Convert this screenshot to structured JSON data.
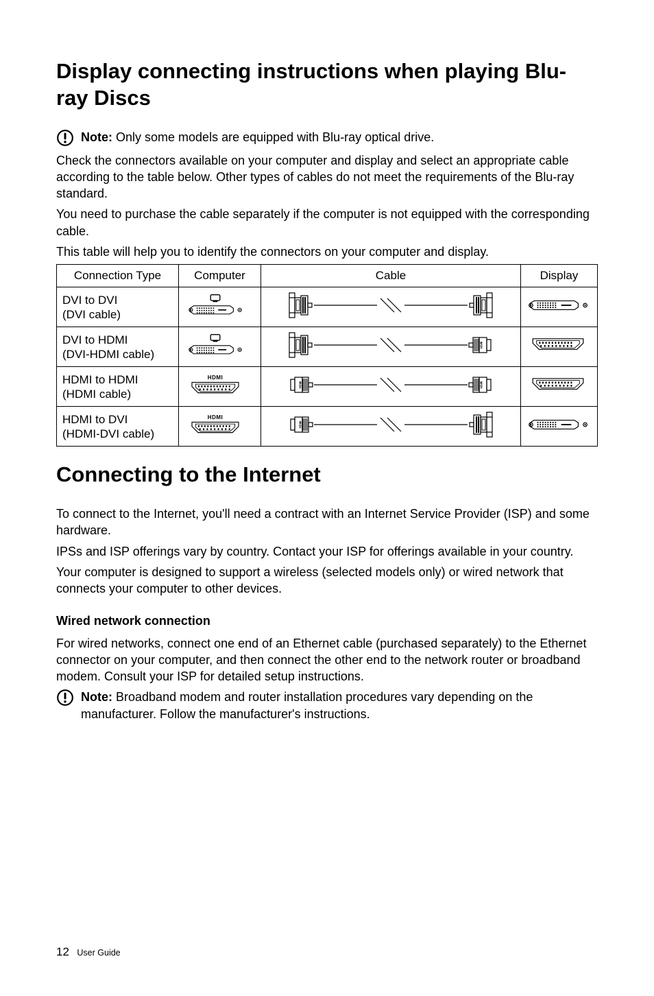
{
  "headings": {
    "display_instructions": "Display connecting instructions when playing Blu-ray Discs",
    "connecting_internet": "Connecting to the Internet"
  },
  "notes": {
    "label": "Note:",
    "bluray": "Only some models are equipped with Blu-ray optical drive.",
    "broadband": "Broadband modem and router installation procedures vary depending on the manufacturer. Follow the manufacturer's instructions."
  },
  "paragraphs": {
    "check_connectors": "Check the connectors available on your computer and display and select an appropriate cable according to the table below. Other types of cables do not meet the requirements of the Blu-ray standard.",
    "purchase_cable": "You need to purchase the cable separately if the computer is not equipped with the corresponding cable.",
    "table_intro": "This table will help you to identify the connectors on your computer and display.",
    "internet_intro": "To connect to the Internet, you'll need a contract with an Internet Service Provider (ISP) and some hardware.",
    "isp_vary": "IPSs and ISP offerings vary by country. Contact your ISP for offerings available in your country.",
    "wireless_wired": "Your computer is designed to support a wireless (selected models only) or wired network that connects your computer to other devices.",
    "wired_instructions": "For wired networks, connect one end of an Ethernet cable (purchased separately) to the Ethernet connector on your computer, and then connect the other end to the network router or broadband modem. Consult your ISP for detailed setup instructions."
  },
  "subheads": {
    "wired": "Wired network connection"
  },
  "table": {
    "headers": {
      "connection_type": "Connection Type",
      "computer": "Computer",
      "cable": "Cable",
      "display": "Display"
    },
    "rows": [
      {
        "type1": "DVI to DVI",
        "type2": "(DVI cable)",
        "computer": "dvi",
        "display": "dvi",
        "cable_left": "dvi",
        "cable_right": "dvi"
      },
      {
        "type1": "DVI to HDMI",
        "type2": "(DVI-HDMI cable)",
        "computer": "dvi",
        "display": "hdmi",
        "cable_left": "dvi",
        "cable_right": "hdmi"
      },
      {
        "type1": "HDMI to HDMI",
        "type2": "(HDMI cable)",
        "computer": "hdmi",
        "display": "hdmi",
        "cable_left": "hdmi",
        "cable_right": "hdmi"
      },
      {
        "type1": "HDMI to DVI",
        "type2": "(HDMI-DVI cable)",
        "computer": "hdmi",
        "display": "dvi",
        "cable_left": "hdmi",
        "cable_right": "dvi"
      }
    ]
  },
  "footer": {
    "page_number": "12",
    "label": "User Guide"
  }
}
